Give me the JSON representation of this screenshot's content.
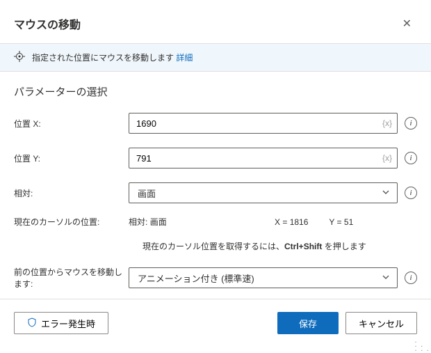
{
  "header": {
    "title": "マウスの移動"
  },
  "info": {
    "text": "指定された位置にマウスを移動します",
    "link": "詳細"
  },
  "section_title": "パラメーターの選択",
  "fields": {
    "posX": {
      "label": "位置 X:",
      "value": "1690",
      "suffix": "{x}"
    },
    "posY": {
      "label": "位置 Y:",
      "value": "791",
      "suffix": "{x}"
    },
    "relative": {
      "label": "相対:",
      "value": "画面"
    },
    "cursor": {
      "label": "現在のカーソルの位置:",
      "rel_prefix": "相対:",
      "rel_value": "画面",
      "x_label": "X =",
      "x_value": "1816",
      "y_label": "Y =",
      "y_value": "51"
    },
    "tip": {
      "prefix": "現在のカーソル位置を取得するには、",
      "key": "Ctrl+Shift",
      "suffix": " を押します"
    },
    "animate": {
      "label": "前の位置からマウスを移動します:",
      "value": "アニメーション付き (標準速)"
    }
  },
  "footer": {
    "onError": "エラー発生時",
    "save": "保存",
    "cancel": "キャンセル"
  }
}
